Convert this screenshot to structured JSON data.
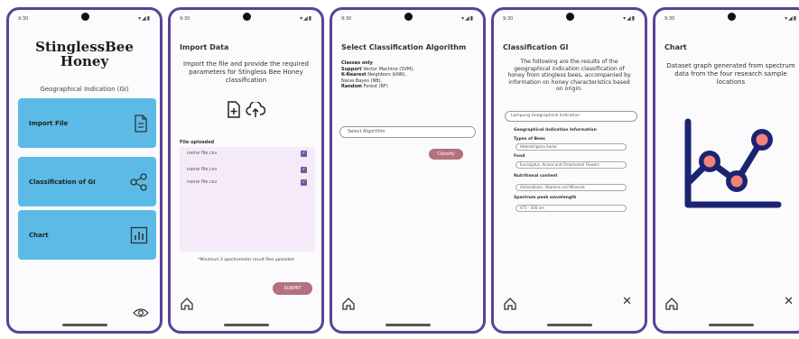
{
  "colors": {
    "frame": "#5a4296",
    "card": "#5bbbe6",
    "button": "#b5707f",
    "chart_navy": "#1a2472",
    "chart_coral": "#f2837a"
  },
  "screens": [
    {
      "time": "9:30",
      "app_title": "StinglessBee Honey",
      "subtitle": "Geographical Indication (GI)",
      "menu": [
        {
          "label": "Import File",
          "icon": "file-icon"
        },
        {
          "label": "Classification of GI",
          "icon": "share-icon"
        },
        {
          "label": "Chart",
          "icon": "chart-icon"
        }
      ],
      "footer_icon": "eye-icon"
    },
    {
      "time": "9:30",
      "title": "Import Data",
      "description": "Import the file and provide the required parameters for Stingless Bee Honey classification",
      "files_label": "File uploaded",
      "files": [
        "name file.csv",
        "name file.csv",
        "name file.csv"
      ],
      "note": "*Minimum 3 spectrometer result files uploaded",
      "button": "SUBMIT"
    },
    {
      "time": "9:30",
      "title": "Select Classification Algorithm",
      "info": [
        {
          "key": "Classes only",
          "value": ""
        },
        {
          "key": "Support",
          "value": "Vector Machine (SVM),"
        },
        {
          "key": "K-Nearest",
          "value": "Neighbors (kNN),"
        },
        {
          "key": "Naive Bayes",
          "value": "(NB),"
        },
        {
          "key": "Random",
          "value": "Forest (RF)"
        }
      ],
      "select_value": "Select Algorithm",
      "button": "Classify"
    },
    {
      "time": "9:30",
      "title": "Classification GI",
      "description": "The following are the results of the geographical indication classification of honey from stingless bees, accompanied by information on honey characteristics based on origin.",
      "result": "Lampung Geographical Indication",
      "section": "Geographical Indication Information",
      "fields": [
        {
          "label": "Types of Bees",
          "value": "Heterotrigona itama"
        },
        {
          "label": "Food",
          "value": "Eucalyptus, Acacia and Ornamental Flowers"
        },
        {
          "label": "Nutritional content",
          "value": "Antioxidants, Vitamins and Minerals"
        },
        {
          "label": "Spectrum peak wavelength",
          "value": "475 - 500 nm"
        }
      ]
    },
    {
      "time": "9:30",
      "title": "Chart",
      "description": "Dataset graph generated from spectrum data from the four research sample locations"
    }
  ]
}
